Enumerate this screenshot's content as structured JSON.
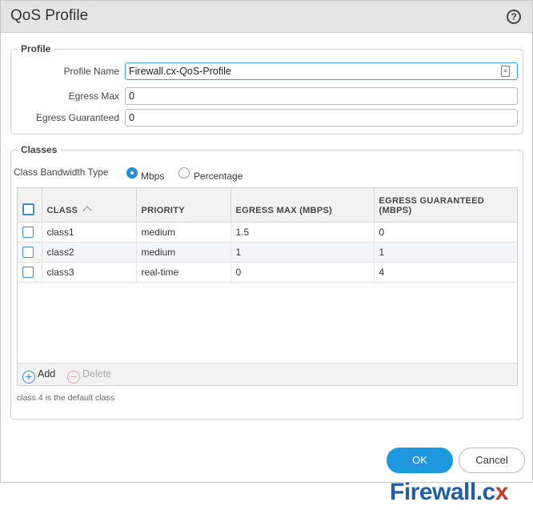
{
  "dialog": {
    "title": "QoS Profile",
    "help_icon": "question-circle-icon"
  },
  "profile": {
    "legend": "Profile",
    "fields": {
      "profile_name": {
        "label": "Profile Name",
        "value": "Firewall.cx-QoS-Profile"
      },
      "egress_max": {
        "label": "Egress Max",
        "value": "0"
      },
      "egress_guaranteed": {
        "label": "Egress Guaranteed",
        "value": "0"
      }
    }
  },
  "classes": {
    "legend": "Classes",
    "bandwidth_type": {
      "label": "Class Bandwidth Type",
      "options": [
        "Mbps",
        "Percentage"
      ],
      "selected": "Mbps"
    },
    "table": {
      "columns": [
        "CLASS",
        "PRIORITY",
        "EGRESS MAX (MBPS)",
        "EGRESS GUARANTEED (MBPS)"
      ],
      "rows": [
        {
          "class": "class1",
          "priority": "medium",
          "egress_max": "1.5",
          "egress_guaranteed": "0"
        },
        {
          "class": "class2",
          "priority": "medium",
          "egress_max": "1",
          "egress_guaranteed": "1"
        },
        {
          "class": "class3",
          "priority": "real-time",
          "egress_max": "0",
          "egress_guaranteed": "4"
        }
      ]
    },
    "toolbar": {
      "add_label": "Add",
      "delete_label": "Delete"
    },
    "note": "class 4 is the default class"
  },
  "buttons": {
    "ok": "OK",
    "cancel": "Cancel"
  },
  "watermark": {
    "text_main": "Firewall.c",
    "text_accent": "x"
  },
  "colors": {
    "accent": "#1b98e0",
    "titlebar": "#e4e4e4",
    "logo_blue": "#1f5fa8",
    "logo_red": "#c0392b"
  }
}
